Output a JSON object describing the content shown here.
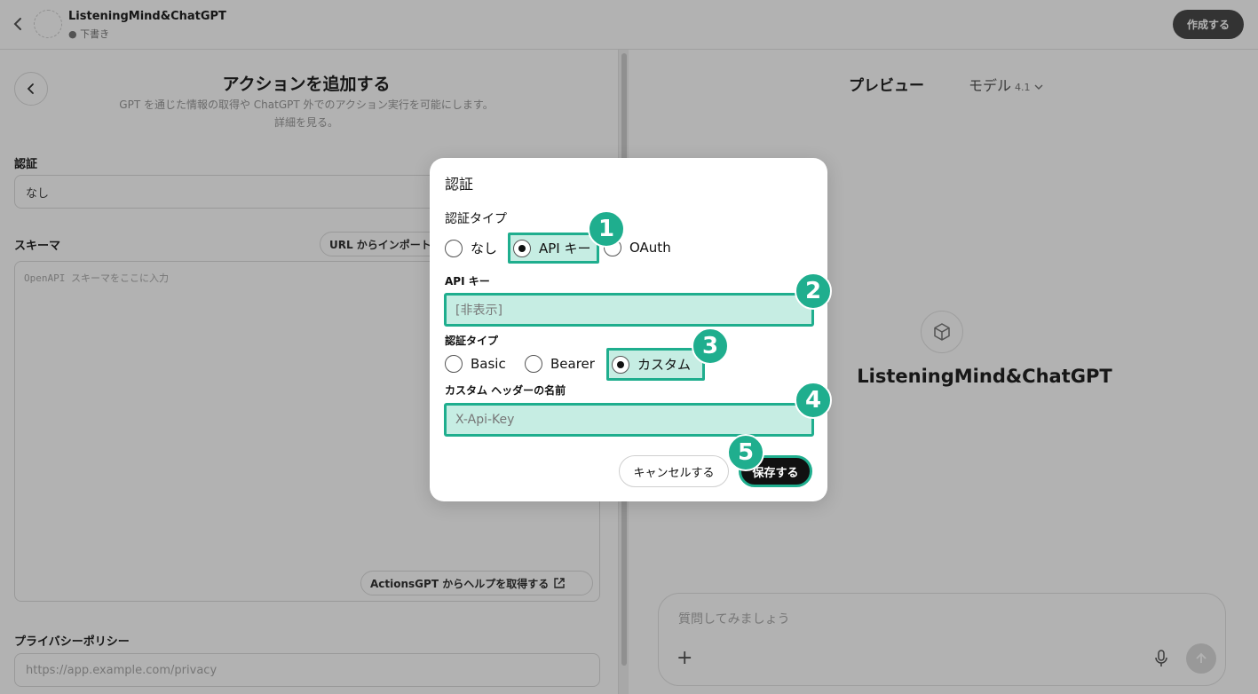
{
  "topbar": {
    "gpt_name": "ListeningMind&ChatGPT",
    "status": "● 下書き",
    "create_label": "作成する"
  },
  "left": {
    "title": "アクションを追加する",
    "subtitle": "GPT を通じた情報の取得や ChatGPT 外でのアクション実行を可能にします。",
    "learn_more": "詳細を見る。",
    "auth_label": "認証",
    "auth_value": "なし",
    "schema_label": "スキーマ",
    "import_url_label": "URL からインポート",
    "schema_placeholder": "OpenAPI スキーマをここに入力",
    "help_label": "ActionsGPT からヘルプを取得する",
    "privacy_label": "プライバシーポリシー",
    "privacy_placeholder": "https://app.example.com/privacy"
  },
  "right": {
    "preview_title": "プレビュー",
    "model_label": "モデル",
    "model_version": "4.1",
    "gpt_name": "ListeningMind&ChatGPT",
    "composer_placeholder": "質問してみましょう"
  },
  "modal": {
    "title": "認証",
    "auth_type_label": "認証タイプ",
    "auth_options": [
      "なし",
      "API キー",
      "OAuth"
    ],
    "auth_selected": "API キー",
    "api_key_label": "API キー",
    "api_key_value": "[非表示]",
    "key_auth_type_label": "認証タイプ",
    "key_auth_options": [
      "Basic",
      "Bearer",
      "カスタム"
    ],
    "key_auth_selected": "カスタム",
    "header_name_label": "カスタム ヘッダーの名前",
    "header_name_value": "X-Api-Key",
    "cancel_label": "キャンセルする",
    "save_label": "保存する"
  },
  "badges": [
    "1",
    "2",
    "3",
    "4",
    "5"
  ],
  "colors": {
    "highlight": "#1fae8e",
    "highlight_fill": "#c6ede3",
    "overlay": "rgba(0,0,0,0.30)"
  }
}
